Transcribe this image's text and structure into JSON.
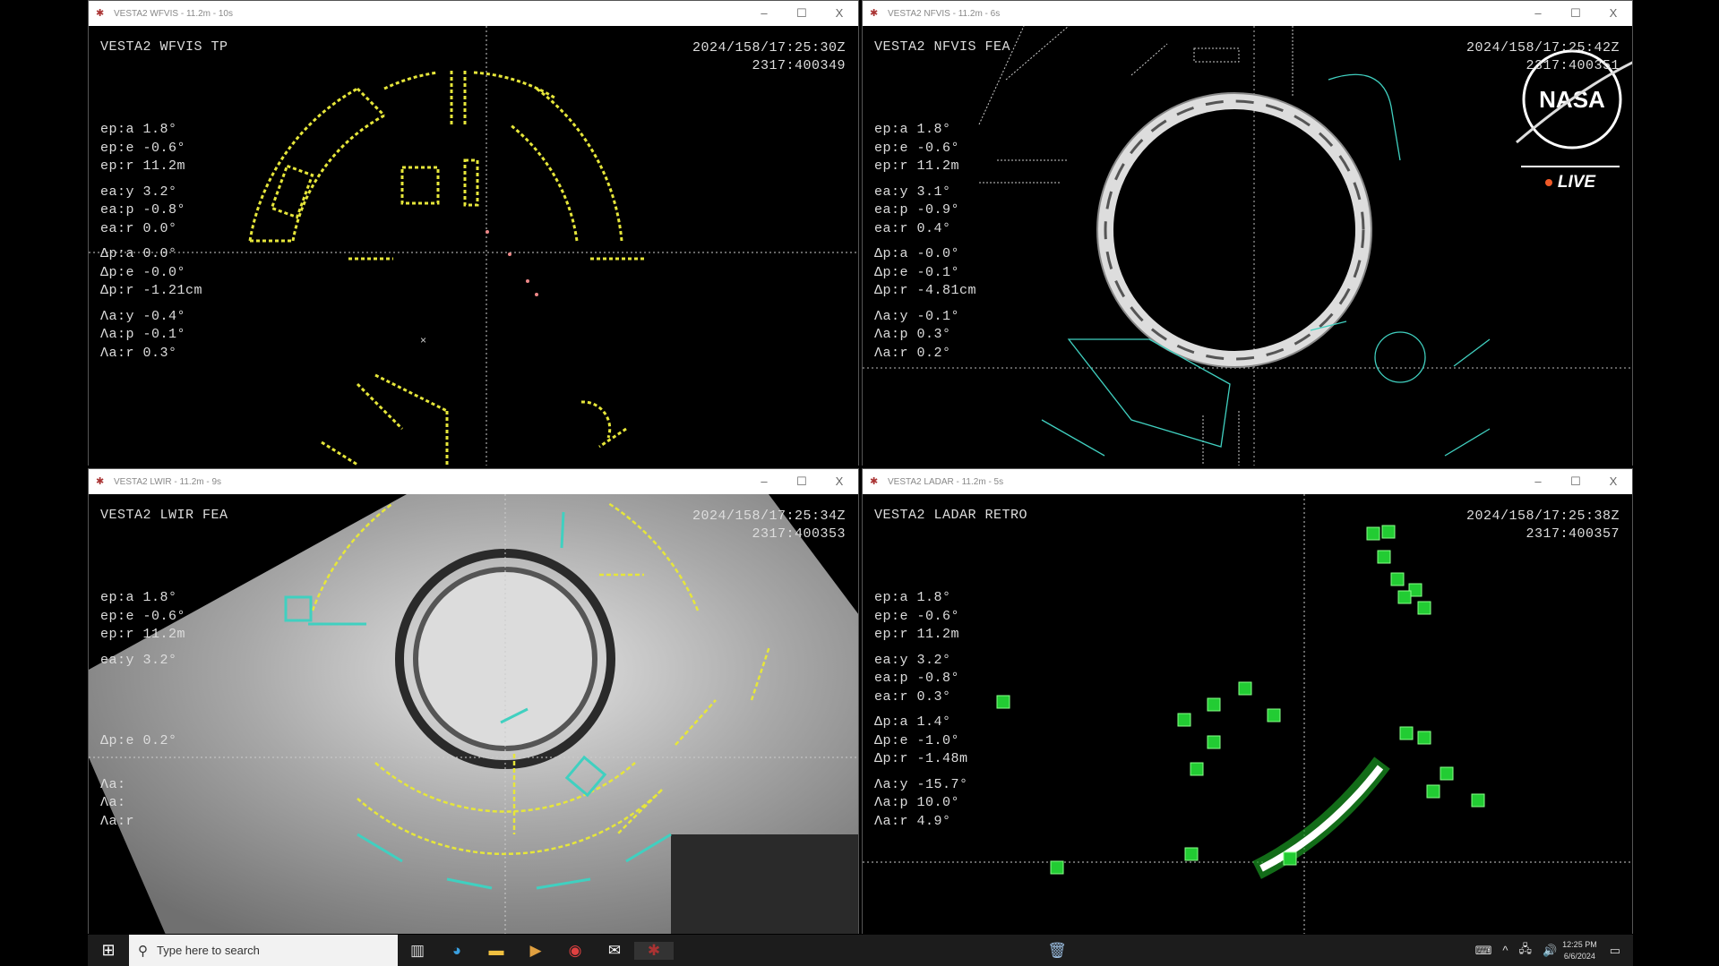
{
  "windows": [
    {
      "id": "wfvis",
      "title": "VESTA2 WFVIS - 11.2m - 10s",
      "name": "VESTA2 WFVIS TP",
      "timestamp": "2024/158/17:25:30Z",
      "counter": "2317:400349",
      "stats": [
        [
          "ep:a 1.8°",
          "ep:e -0.6°",
          "ep:r 11.2m"
        ],
        [
          "ea:y 3.2°",
          "ea:p -0.8°",
          "ea:r 0.0°"
        ],
        [
          "Δp:a 0.0°",
          "Δp:e -0.0°",
          "Δp:r -1.21cm"
        ],
        [
          "Λa:y -0.4°",
          "Λa:p -0.1°",
          "Λa:r 0.3°"
        ]
      ]
    },
    {
      "id": "nfvis",
      "title": "VESTA2 NFVIS - 11.2m - 6s",
      "name": "VESTA2 NFVIS FEA",
      "timestamp": "2024/158/17:25:42Z",
      "counter": "2317:400351",
      "stats": [
        [
          "ep:a 1.8°",
          "ep:e -0.6°",
          "ep:r 11.2m"
        ],
        [
          "ea:y 3.1°",
          "ea:p -0.9°",
          "ea:r 0.4°"
        ],
        [
          "Δp:a -0.0°",
          "Δp:e -0.1°",
          "Δp:r -4.81cm"
        ],
        [
          "Λa:y -0.1°",
          "Λa:p 0.3°",
          "Λa:r 0.2°"
        ]
      ]
    },
    {
      "id": "lwir",
      "title": "VESTA2 LWIR - 11.2m - 9s",
      "name": "VESTA2 LWIR FEA",
      "timestamp": "2024/158/17:25:34Z",
      "counter": "2317:400353",
      "stats": [
        [
          "ep:a 1.8°",
          "ep:e -0.6°",
          "ep:r 11.2m"
        ],
        [
          "ea:y 3.2°",
          "",
          ""
        ],
        [
          "",
          "Δp:e 0.2°",
          ""
        ],
        [
          "Λa:",
          "Λa:",
          "Λa:r"
        ]
      ]
    },
    {
      "id": "ladar",
      "title": "VESTA2 LADAR - 11.2m - 5s",
      "name": "VESTA2 LADAR RETRO",
      "timestamp": "2024/158/17:25:38Z",
      "counter": "2317:400357",
      "stats": [
        [
          "ep:a 1.8°",
          "ep:e -0.6°",
          "ep:r 11.2m"
        ],
        [
          "ea:y 3.2°",
          "ea:p -0.8°",
          "ea:r 0.3°"
        ],
        [
          "Δp:a 1.4°",
          "Δp:e -1.0°",
          "Δp:r -1.48m"
        ],
        [
          "Λa:y -15.7°",
          "Λa:p 10.0°",
          "Λa:r 4.9°"
        ]
      ]
    }
  ],
  "window_controls": {
    "minimize": "–",
    "maximize": "☐",
    "close": "X"
  },
  "overlay": {
    "logo": "NASA",
    "live": "LIVE"
  },
  "taskbar": {
    "search_placeholder": "Type here to search",
    "clock_time": "12:25 PM",
    "clock_date": "6/6/2024"
  },
  "colors": {
    "overlay_yellow": "#e6e63a",
    "overlay_cyan": "#40d0c0",
    "ladar_green": "#22cc33",
    "live_dot": "#f05a28"
  }
}
